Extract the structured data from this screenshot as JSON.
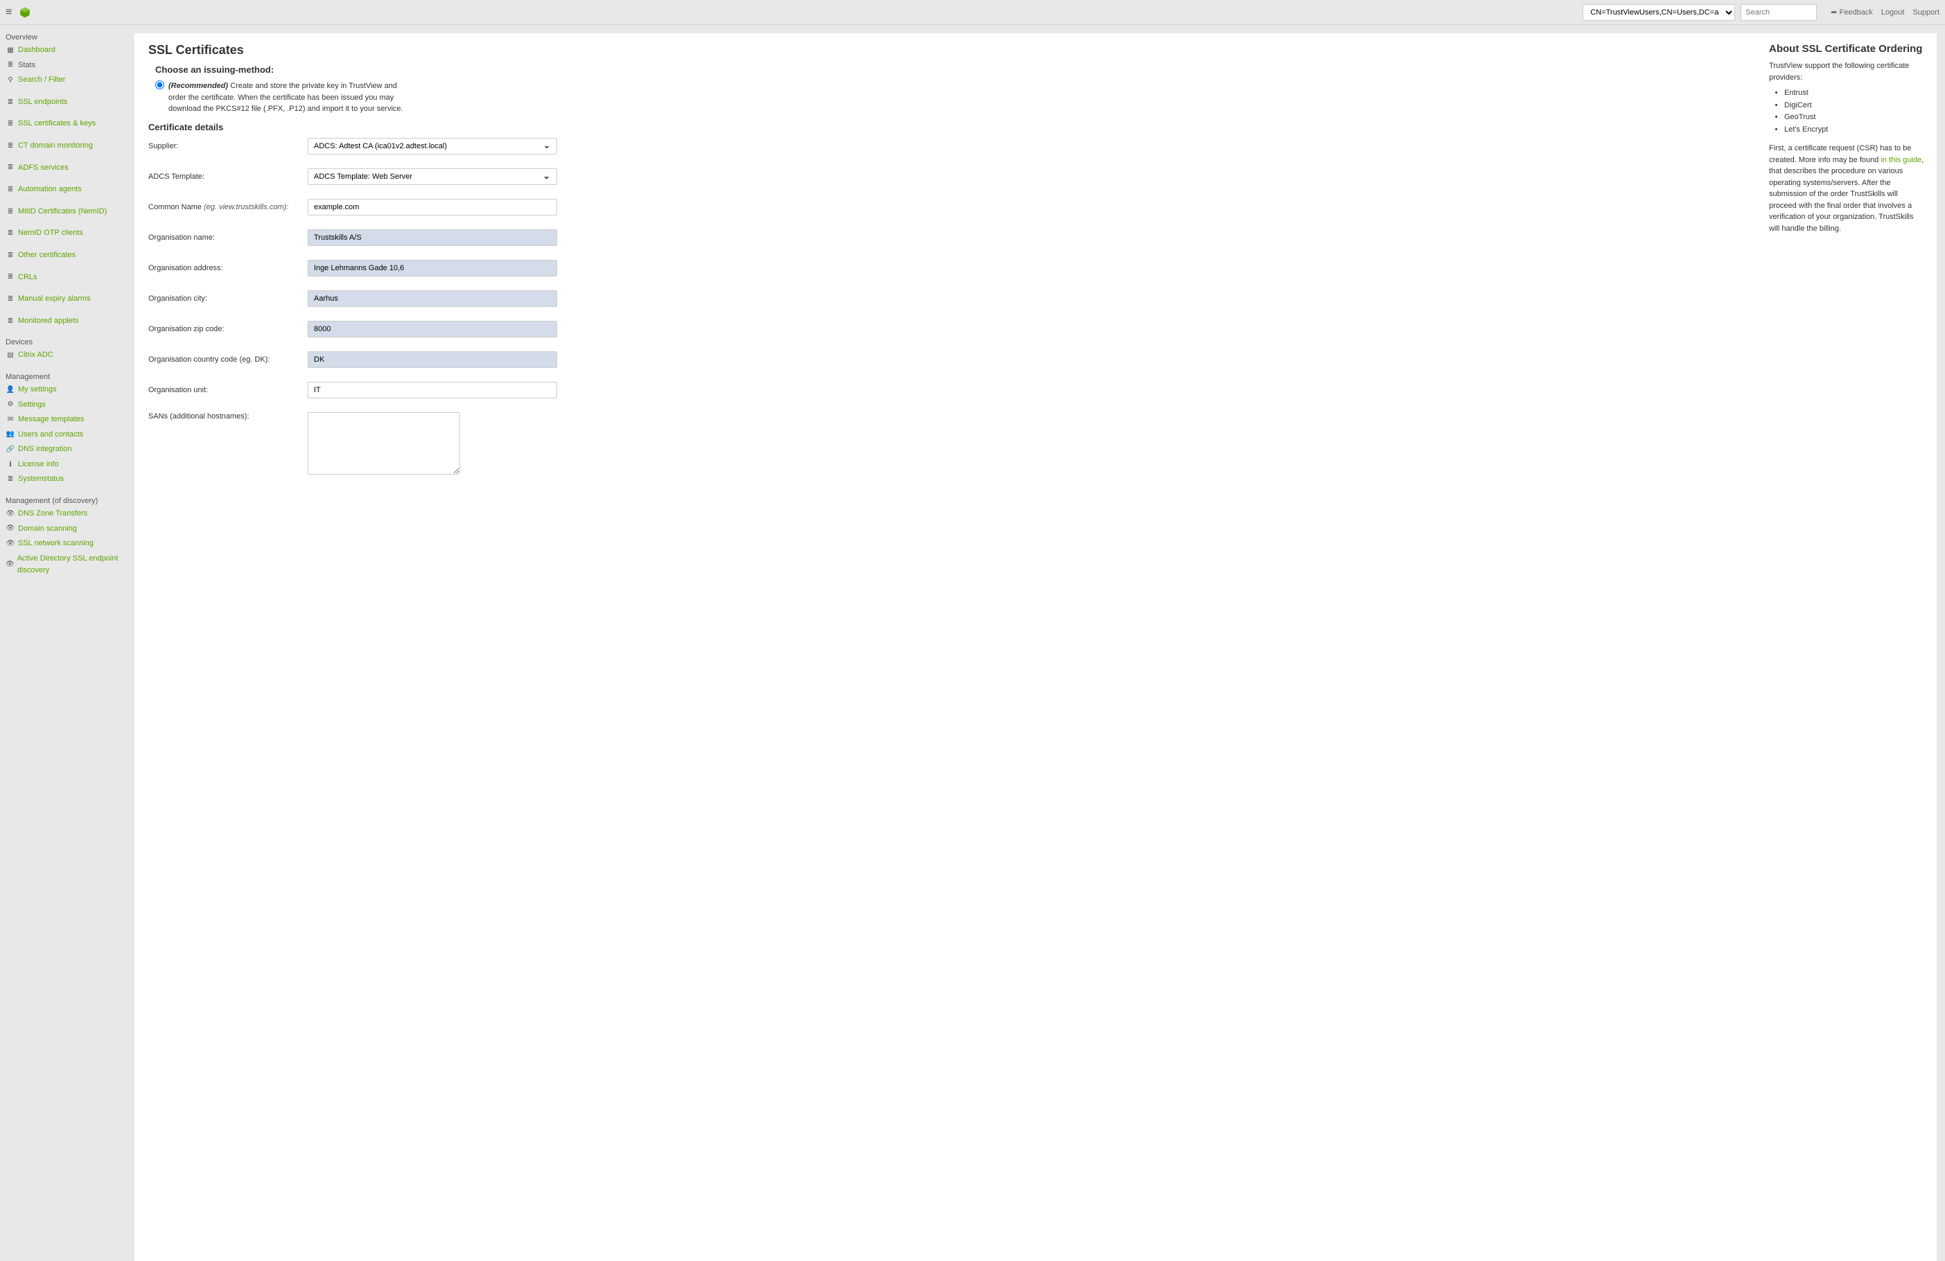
{
  "topbar": {
    "path_select": "CN=TrustViewUsers,CN=Users,DC=adtest,DC=local",
    "search_placeholder": "Search",
    "feedback": "Feedback",
    "logout": "Logout",
    "support": "Support"
  },
  "sidebar": {
    "overview_title": "Overview",
    "dashboard": "Dashboard",
    "stats": "Stats",
    "search_filter": "Search / Filter",
    "ssl_endpoints": "SSL endpoints",
    "ssl_certs_keys": "SSL certificates & keys",
    "ct_domain": "CT domain monitoring",
    "adfs": "ADFS services",
    "automation": "Automation agents",
    "mitid": "MitID Certificates (NemID)",
    "nemid_otp": "NemID OTP clients",
    "other_certs": "Other certificates",
    "crls": "CRLs",
    "manual_expiry": "Manual expiry alarms",
    "monitored_applets": "Monitored applets",
    "devices_title": "Devices",
    "citrix": "Citrix ADC",
    "mgmt_title": "Management",
    "my_settings": "My settings",
    "settings": "Settings",
    "msg_templates": "Message templates",
    "users_contacts": "Users and contacts",
    "dns_integration": "DNS integration",
    "license": "License info",
    "systemstatus": "Systemstatus",
    "mgmt_discovery_title": "Management (of discovery)",
    "dns_zone": "DNS Zone Transfers",
    "domain_scanning": "Domain scanning",
    "ssl_network": "SSL network scanning",
    "ad_ssl": "Active Directory SSL endpoint discovery"
  },
  "main": {
    "title": "SSL Certificates",
    "issuing_title": "Choose an issuing-method:",
    "issuing_recommended": "(Recommended)",
    "issuing_text": "Create and store the private key in TrustView and order the certificate. When the certificate has been issued you may download the PKCS#12 file (.PFX, .P12) and import it to your service.",
    "details_title": "Certificate details",
    "labels": {
      "supplier": "Supplier:",
      "adcs_template": "ADCS Template:",
      "common_name": "Common Name",
      "common_name_hint": " (eg. view.trustskills.com):",
      "org_name": "Organisation name:",
      "org_address": "Organisation address:",
      "org_city": "Organisation city:",
      "org_zip": "Organisation zip code:",
      "org_country": "Organisation country code (eg. DK):",
      "org_unit": "Organisation unit:",
      "sans": "SANs (additional hostnames):"
    },
    "values": {
      "supplier": "ADCS: Adtest CA (ica01v2.adtest.local)",
      "adcs_template": "ADCS Template: Web Server",
      "common_name": "example.com",
      "org_name": "Trustskills A/S",
      "org_address": "Inge Lehmanns Gade 10,6",
      "org_city": "Aarhus",
      "org_zip": "8000",
      "org_country": "DK",
      "org_unit": "IT",
      "sans": ""
    }
  },
  "right": {
    "title": "About SSL Certificate Ordering",
    "intro": "TrustView support the following certificate providers:",
    "providers": [
      "Entrust",
      "DigiCert",
      "GeoTrust",
      "Let's Encrypt"
    ],
    "p2a": "First, a certificate request (CSR) has to be created. More info may be found ",
    "p2link": "in this guide",
    "p2b": ", that describes the procedure on various operating systems/servers. After the submission of the order TrustSkills will proceed with the final order that involves a verification of your organization. TrustSkills will handle the billing."
  }
}
